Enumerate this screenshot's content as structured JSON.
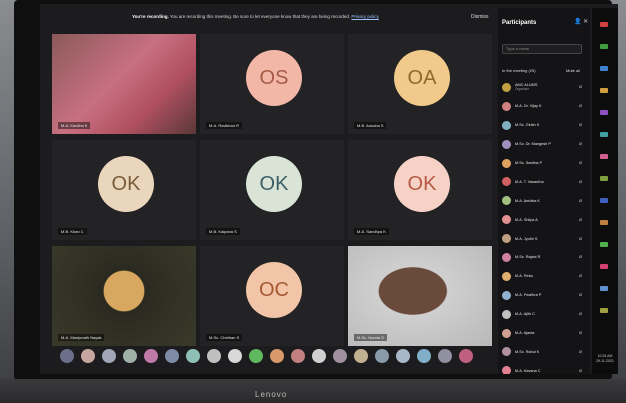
{
  "banner": {
    "bold": "You're recording.",
    "text": "You are recording this meeting. Be sure to let everyone know that they are being recorded.",
    "link": "Privacy policy"
  },
  "dismiss_label": "Dismiss",
  "tiles": [
    {
      "type": "video",
      "label": "M.A. Kavitha K",
      "gradient": "linear-gradient(135deg,#8a5a5a,#c87080 45%,#b05060 70%,#5a3838)"
    },
    {
      "type": "avatar",
      "initials": "OS",
      "label": "M.A. Ravikiran R",
      "bg": "#f2b7a6",
      "fg": "#a55b48"
    },
    {
      "type": "avatar",
      "initials": "OA",
      "label": "M.B. Anusha S",
      "bg": "#f1c98a",
      "fg": "#8f6a2a"
    },
    {
      "type": "avatar",
      "initials": "OK",
      "label": "M.B. Kiran C",
      "bg": "#ead6bd",
      "fg": "#7a5c3a"
    },
    {
      "type": "avatar",
      "initials": "OK",
      "label": "M.B. Kalpana S",
      "bg": "#d9e4d7",
      "fg": "#3c5f66"
    },
    {
      "type": "avatar",
      "initials": "OK",
      "label": "M.A. Sandhya K",
      "bg": "#f6d2c6",
      "fg": "#b65a45"
    },
    {
      "type": "video",
      "label": "M.A. Manjunath Nayak",
      "gradient": "radial-gradient(circle at 50% 45%,#d8a860 0 22%,#2a2a20 23%,#3a3a2a 100%)"
    },
    {
      "type": "avatar",
      "initials": "OC",
      "label": "M.Sc. Chethan S",
      "bg": "#f2c5a8",
      "fg": "#a55a32"
    },
    {
      "type": "video",
      "label": "M.Sc. Nanda S",
      "gradient": "radial-gradient(ellipse at 45% 45%,#6a4a3a 0 30%,#cfcfcf 31%,#b8b8b8 100%)"
    }
  ],
  "toolbar_colors": [
    "#6b6f8a",
    "#c7a6a0",
    "#a0a6b8",
    "#9fb0a8",
    "#c07aa8",
    "#7f8aa8",
    "#8fc0b8",
    "#c0c0c0",
    "#d8d8d8",
    "#5fb85f",
    "#d89a6a",
    "#c08080",
    "#d0d0d0",
    "#a090a0",
    "#c0b090",
    "#8a9aa8",
    "#a8b8c8",
    "#7fb0c8",
    "#9090a0",
    "#c06080"
  ],
  "panel": {
    "title": "Participants",
    "search_placeholder": "Type a name",
    "in_meeting": "In the meeting (25)",
    "mute_all": "Mute all",
    "participants": [
      {
        "name": "AMC ALUMS",
        "sub": "Organiser",
        "color": "#c0a040"
      },
      {
        "name": "M.A. Dr. Vijay K",
        "sub": "",
        "color": "#d08080"
      },
      {
        "name": "M.Sc. Girish K",
        "sub": "",
        "color": "#80b0c0"
      },
      {
        "name": "M.Sc. Dr. Mangesh P",
        "sub": "",
        "color": "#a090c0"
      },
      {
        "name": "M.Sc. Savitha P",
        "sub": "",
        "color": "#e0a060"
      },
      {
        "name": "M.A. T. Vasantha",
        "sub": "",
        "color": "#d06060"
      },
      {
        "name": "M.A. Ambika K",
        "sub": "",
        "color": "#a0c080"
      },
      {
        "name": "M.A. Shilpa A",
        "sub": "",
        "color": "#e09090"
      },
      {
        "name": "M.A. Jyothi S",
        "sub": "",
        "color": "#c0a080"
      },
      {
        "name": "M.Sc. Rajani R",
        "sub": "",
        "color": "#d080a0"
      },
      {
        "name": "M.A. Reka",
        "sub": "",
        "color": "#e0b070"
      },
      {
        "name": "M.A. Pavithra P",
        "sub": "",
        "color": "#90b0d0"
      },
      {
        "name": "M.A. Ajith C",
        "sub": "",
        "color": "#c0c0c0"
      },
      {
        "name": "M.A. Ajanta",
        "sub": "",
        "color": "#d0a090"
      },
      {
        "name": "M.Sc. Rahul K",
        "sub": "",
        "color": "#b090a0"
      },
      {
        "name": "M.A. Kavana C",
        "sub": "",
        "color": "#e08090"
      }
    ]
  },
  "rail_colors": [
    "#d04040",
    "#40a040",
    "#4080d0",
    "#d0a040",
    "#9050c0",
    "#40a0a0",
    "#d06090",
    "#80a040",
    "#4060c0",
    "#c08040",
    "#50b050",
    "#d04070",
    "#6090d0",
    "#a0a040"
  ],
  "clock": {
    "time": "10:24 AM",
    "date": "29-11-2021"
  },
  "brand": "Lenovo"
}
